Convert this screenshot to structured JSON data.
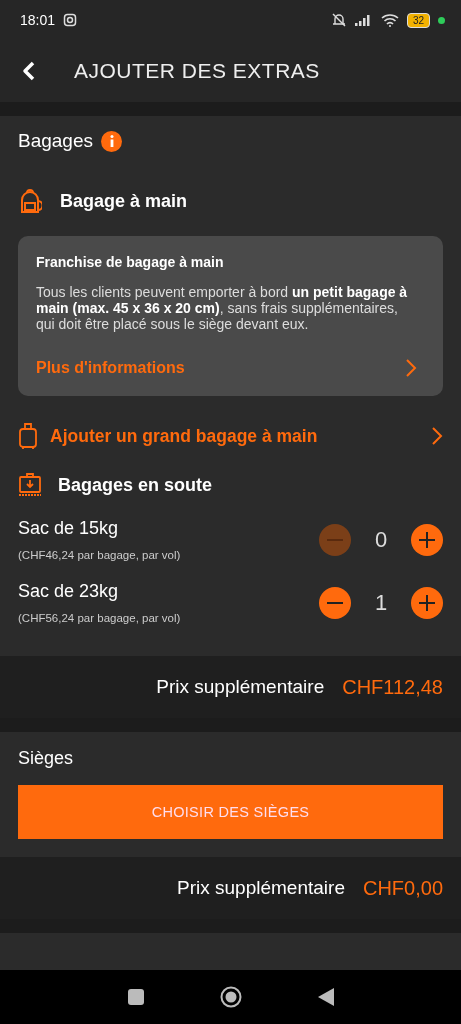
{
  "status_bar": {
    "time": "18:01",
    "battery": "32"
  },
  "header": {
    "title": "AJOUTER DES EXTRAS"
  },
  "baggage": {
    "title": "Bagages",
    "cabin": {
      "title": "Bagage à main"
    },
    "allowance": {
      "title": "Franchise de bagage à main",
      "text": "Tous les clients peuvent emporter à bord **un petit bagage à main (max. 45 x 36 x 20 cm)**, sans frais supplémentaires, qui doit être placé sous le siège devant eux.",
      "link": "Plus d'informations"
    },
    "large_cabin": {
      "label": "Ajouter un grand bagage à main"
    },
    "hold": {
      "title": "Bagages en soute",
      "items": [
        {
          "name": "Sac de 15kg",
          "price": "(CHF46,24 par bagage, par vol)",
          "count": "0",
          "minus_disabled": true
        },
        {
          "name": "Sac de 23kg",
          "price": "(CHF56,24 par bagage, par vol)",
          "count": "1",
          "minus_disabled": false
        }
      ]
    },
    "extra_price": {
      "label": "Prix supplémentaire",
      "amount": "CHF112,48"
    }
  },
  "seats": {
    "title": "Sièges",
    "button": "CHOISIR DES SIÈGES",
    "extra_price": {
      "label": "Prix supplémentaire",
      "amount": "CHF0,00"
    }
  }
}
